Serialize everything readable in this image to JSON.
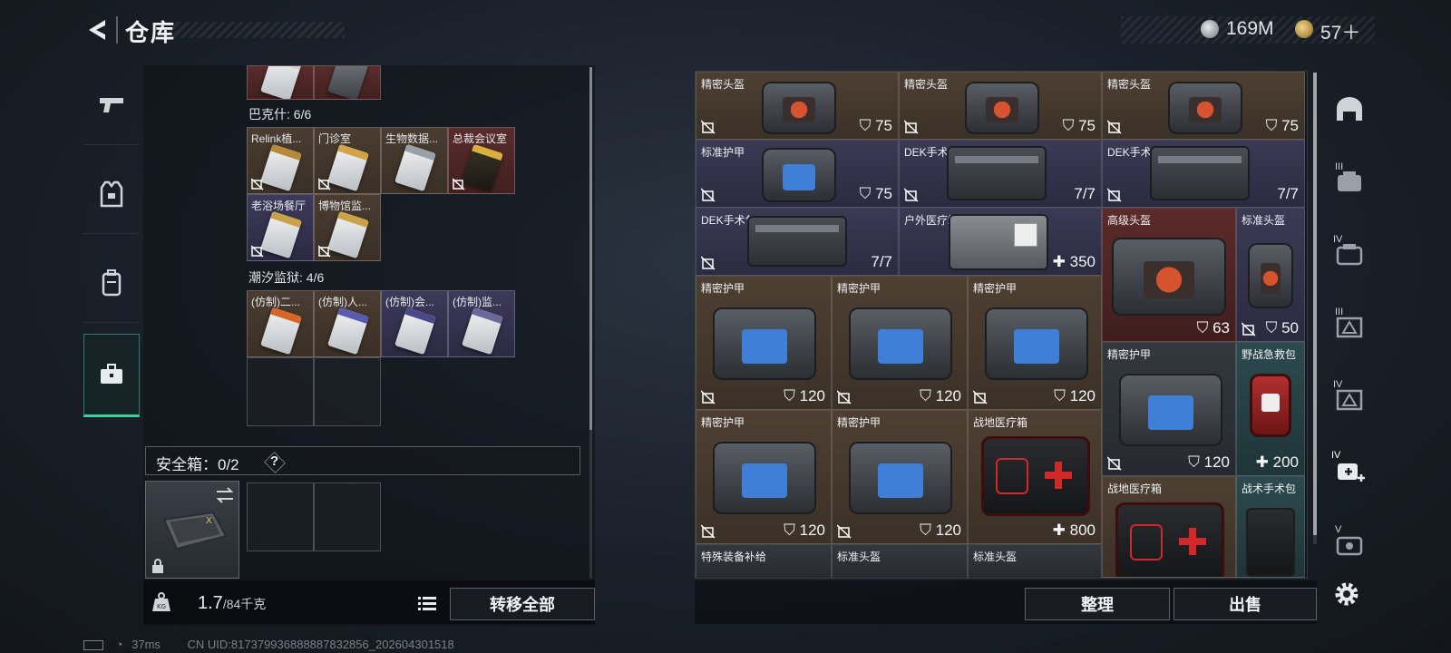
{
  "header": {
    "title": "仓库",
    "currency": [
      {
        "icon": "silver-coin-icon",
        "value": "169M"
      },
      {
        "icon": "gold-coin-icon",
        "value": "57＋"
      }
    ]
  },
  "left_rail": {
    "items": [
      {
        "name": "weapons",
        "icon": "pistol-icon"
      },
      {
        "name": "armor",
        "icon": "vest-icon"
      },
      {
        "name": "backpack",
        "icon": "backpack-icon"
      },
      {
        "name": "keys",
        "icon": "briefcase-icon",
        "active": true
      }
    ]
  },
  "key_groups": [
    {
      "title": "",
      "cards": [
        {
          "label": ""
        },
        {
          "label": ""
        }
      ]
    },
    {
      "title": "巴克什: 6/6",
      "cards": [
        {
          "label": "Relink植..."
        },
        {
          "label": "门诊室"
        },
        {
          "label": "生物数据..."
        },
        {
          "label": "总裁会议室"
        },
        {
          "label": "老浴场餐厅"
        },
        {
          "label": "博物馆监..."
        }
      ]
    },
    {
      "title": "潮汐监狱: 4/6",
      "cards": [
        {
          "label": "(仿制)二..."
        },
        {
          "label": "(仿制)人..."
        },
        {
          "label": "(仿制)会..."
        },
        {
          "label": "(仿制)监..."
        }
      ]
    }
  ],
  "safebox": {
    "label": "安全箱：0/2",
    "help": "?"
  },
  "bottom_left": {
    "weight_current": "1.7",
    "weight_max": "/84千克",
    "weight_icon_label": "KG",
    "transfer_all": "转移全部"
  },
  "items": [
    {
      "name": "精密头盔",
      "value": "75",
      "kind": "durability"
    },
    {
      "name": "精密头盔",
      "value": "75",
      "kind": "durability"
    },
    {
      "name": "精密头盔",
      "value": "75",
      "kind": "durability"
    },
    {
      "name": "标准护甲",
      "value": "75",
      "kind": "durability"
    },
    {
      "name": "DEK手术包",
      "value": "7/7",
      "kind": "uses"
    },
    {
      "name": "DEK手术包",
      "value": "7/7",
      "kind": "uses"
    },
    {
      "name": "DEK手术包",
      "value": "7/7",
      "kind": "uses"
    },
    {
      "name": "户外医疗箱",
      "value": "350",
      "kind": "heal"
    },
    {
      "name": "高级头盔",
      "value": "63",
      "kind": "durability"
    },
    {
      "name": "标准头盔",
      "value": "50",
      "kind": "durability"
    },
    {
      "name": "精密护甲",
      "value": "120",
      "kind": "durability"
    },
    {
      "name": "精密护甲",
      "value": "120",
      "kind": "durability"
    },
    {
      "name": "精密护甲",
      "value": "120",
      "kind": "durability"
    },
    {
      "name": "精密护甲",
      "value": "120",
      "kind": "durability"
    },
    {
      "name": "野战急救包",
      "value": "200",
      "kind": "heal"
    },
    {
      "name": "精密护甲",
      "value": "120",
      "kind": "durability"
    },
    {
      "name": "精密护甲",
      "value": "120",
      "kind": "durability"
    },
    {
      "name": "战地医疗箱",
      "value": "800",
      "kind": "heal"
    },
    {
      "name": "战地医疗箱",
      "value": "",
      "kind": "heal"
    },
    {
      "name": "战术手术包",
      "value": "",
      "kind": "uses"
    },
    {
      "name": "特殊装备补给",
      "value": "",
      "kind": "none"
    },
    {
      "name": "标准头盔",
      "value": "",
      "kind": "none"
    },
    {
      "name": "标准头盔",
      "value": "",
      "kind": "none"
    }
  ],
  "bottom_right": {
    "sort": "整理",
    "sell": "出售"
  },
  "right_rail": {
    "items": [
      {
        "label": "",
        "icon": "helmet-icon"
      },
      {
        "label": "III",
        "icon": "armor-tier3-icon"
      },
      {
        "label": "IV",
        "icon": "armor-tier4-icon"
      },
      {
        "label": "III",
        "icon": "helmet-tier3-icon"
      },
      {
        "label": "IV",
        "icon": "helmet-tier4-icon"
      },
      {
        "label": "IV",
        "icon": "medkit-tier4-icon"
      },
      {
        "label": "V",
        "icon": "armor-tier5-icon"
      }
    ]
  },
  "status": {
    "ping": "37ms",
    "uid": "CN UID:817379936888887832856_202604301518"
  },
  "colors": {
    "accent": "#3ad29a",
    "rarity_brown": "#4e3f32",
    "rarity_purple": "#3a3a55",
    "rarity_red": "#5c2a2a",
    "rarity_teal": "#2c4a4e"
  }
}
